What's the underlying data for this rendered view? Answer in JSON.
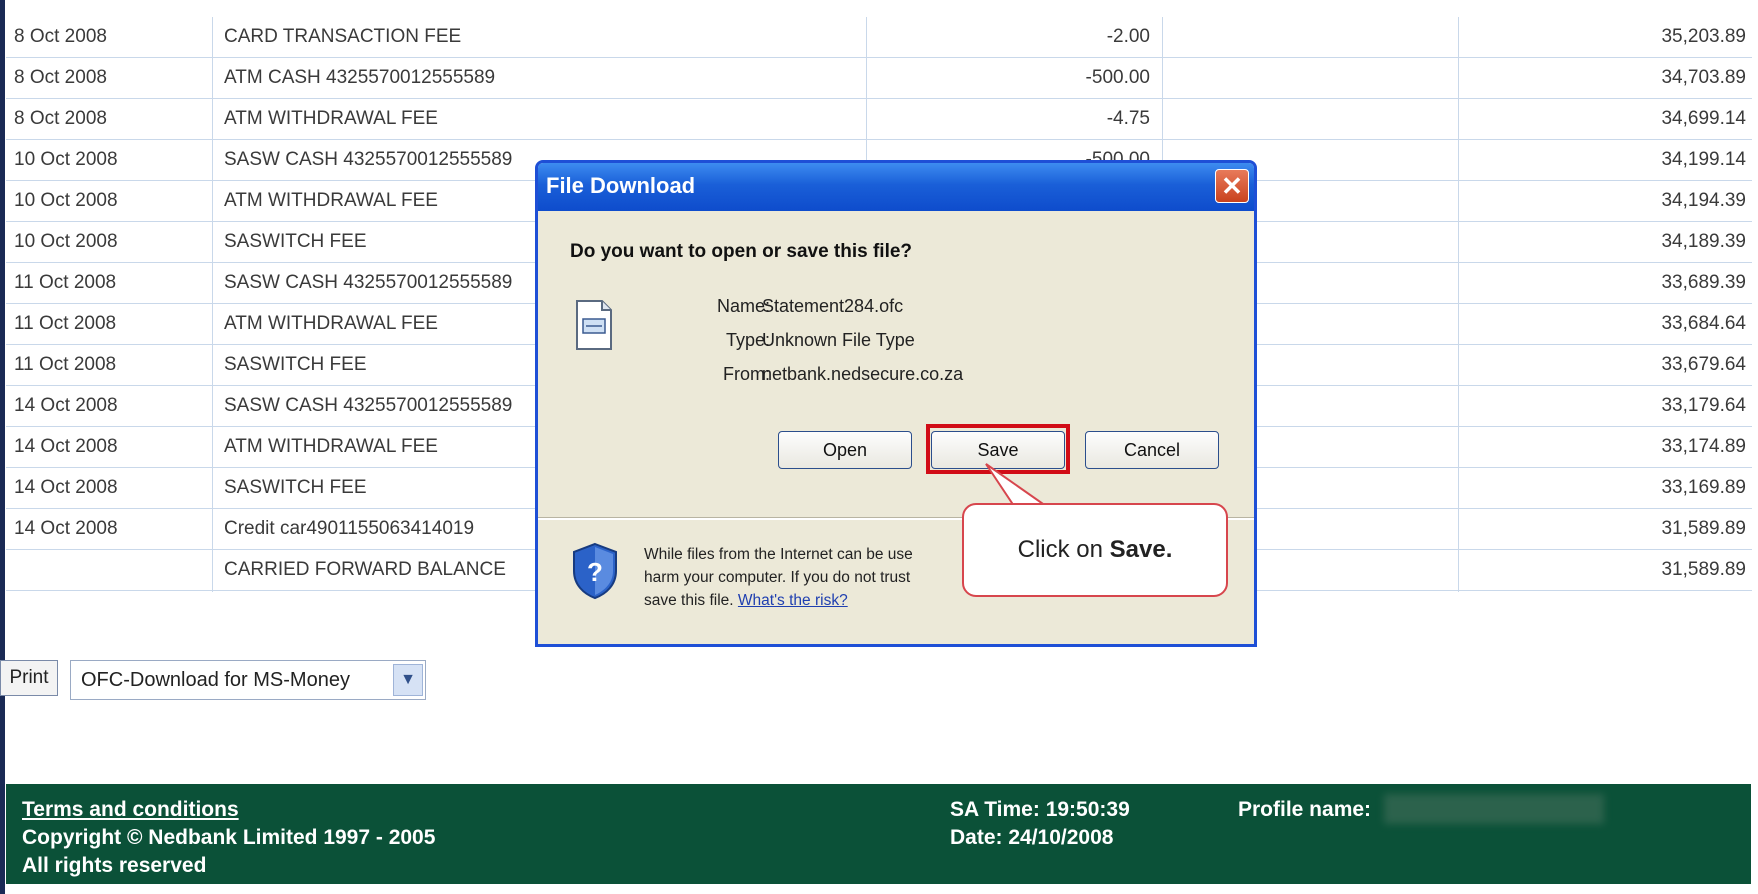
{
  "transactions": [
    {
      "date": "8 Oct 2008",
      "description": "CARD TRANSACTION FEE",
      "amount": "-2.00",
      "balance": "35,203.89"
    },
    {
      "date": "8 Oct 2008",
      "description": "ATM CASH 4325570012555589",
      "amount": "-500.00",
      "balance": "34,703.89"
    },
    {
      "date": "8 Oct 2008",
      "description": "ATM WITHDRAWAL FEE",
      "amount": "-4.75",
      "balance": "34,699.14"
    },
    {
      "date": "10 Oct 2008",
      "description": "SASW CASH 4325570012555589",
      "amount": "-500.00",
      "balance": "34,199.14"
    },
    {
      "date": "10 Oct 2008",
      "description": "ATM WITHDRAWAL FEE",
      "amount": "",
      "balance": "34,194.39"
    },
    {
      "date": "10 Oct 2008",
      "description": "SASWITCH FEE",
      "amount": "",
      "balance": "34,189.39"
    },
    {
      "date": "11 Oct 2008",
      "description": "SASW CASH 4325570012555589",
      "amount": "",
      "balance": "33,689.39"
    },
    {
      "date": "11 Oct 2008",
      "description": "ATM WITHDRAWAL FEE",
      "amount": "",
      "balance": "33,684.64"
    },
    {
      "date": "11 Oct 2008",
      "description": "SASWITCH FEE",
      "amount": "",
      "balance": "33,679.64"
    },
    {
      "date": "14 Oct 2008",
      "description": "SASW CASH 4325570012555589",
      "amount": "",
      "balance": "33,179.64"
    },
    {
      "date": "14 Oct 2008",
      "description": "ATM WITHDRAWAL FEE",
      "amount": "",
      "balance": "33,174.89"
    },
    {
      "date": "14 Oct 2008",
      "description": "SASWITCH FEE",
      "amount": "",
      "balance": "33,169.89"
    },
    {
      "date": "14 Oct 2008",
      "description": "Credit car4901155063414019",
      "amount": "",
      "balance": "31,589.89"
    },
    {
      "date": "",
      "description": "CARRIED FORWARD BALANCE",
      "amount": "",
      "balance": "31,589.89"
    }
  ],
  "controls": {
    "print_label": "Print",
    "download_format": "OFC-Download for MS-Money",
    "dropdown_icon": "chevron-down-icon"
  },
  "dialog": {
    "title": "File Download",
    "close_icon": "close-icon",
    "question": "Do you want to open or save this file?",
    "file_icon": "file-icon",
    "name_label": "Name:",
    "name_value": "Statement284.ofc",
    "type_label": "Type:",
    "type_value": "Unknown File Type",
    "from_label": "From:",
    "from_value": "netbank.nedsecure.co.za",
    "open_label": "Open",
    "save_label": "Save",
    "cancel_label": "Cancel",
    "warning_icon": "shield-question-icon",
    "warning_line1": "While files from the Internet can be use",
    "warning_line2": "harm your computer. If you do not trust",
    "warning_line3": "save this file.",
    "risk_link": "What's the risk?",
    "highlight_color": "#d10c16",
    "accent_color": "#1e4fd6"
  },
  "callout": {
    "prefix": "Click on ",
    "bold": "Save."
  },
  "footer": {
    "terms_link": "Terms and conditions",
    "copyright": "Copyright © Nedbank Limited 1997 - 2005",
    "rights": "All rights reserved",
    "sa_time": "SA Time: 19:50:39",
    "date": "Date: 24/10/2008",
    "profile_label": "Profile name:",
    "background_color": "#0b5138"
  }
}
